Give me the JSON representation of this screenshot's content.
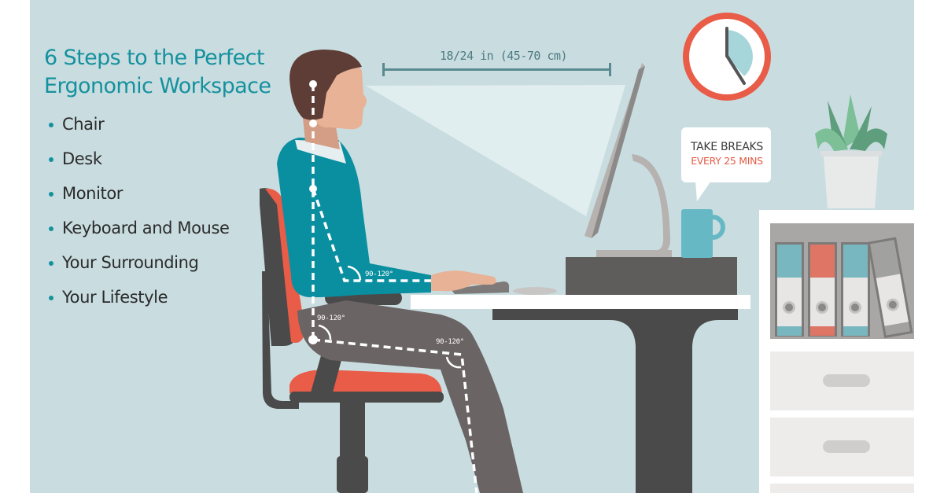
{
  "infographic": {
    "title_line1": "6 Steps to the Perfect",
    "title_line2": "Ergonomic Workspace",
    "steps": [
      {
        "label": "Chair"
      },
      {
        "label": "Desk"
      },
      {
        "label": "Monitor"
      },
      {
        "label": "Keyboard and Mouse"
      },
      {
        "label": "Your Surrounding"
      },
      {
        "label": "Your Lifestyle"
      }
    ],
    "viewing_distance": "18/24 in (45-70 cm)",
    "break_reminder": {
      "line1": "TAKE BREAKS",
      "line2": "EVERY 25 MINS"
    },
    "angles": {
      "elbow": "90-120°",
      "hip": "90-120°",
      "knee": "90-120°"
    }
  },
  "colors": {
    "background": "#c9dde0",
    "accent_teal": "#15919e",
    "shirt": "#0a8fa0",
    "chair_red": "#e85c48",
    "dark_gray": "#4a4a4a",
    "clock_red": "#e85c48"
  }
}
